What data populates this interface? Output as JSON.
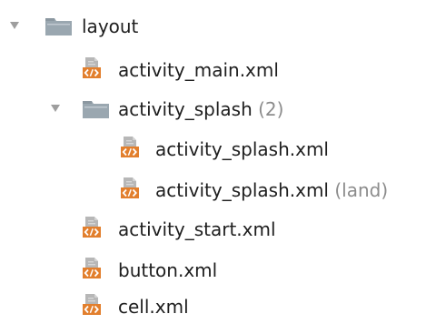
{
  "tree": {
    "layout_folder": {
      "name": "layout",
      "icon": "folder-icon",
      "expanded": true
    },
    "activity_main": {
      "name": "activity_main.xml",
      "icon": "xml-layout-file-icon"
    },
    "activity_splash_group": {
      "name": "activity_splash",
      "count": "(2)",
      "icon": "folder-icon",
      "expanded": true
    },
    "activity_splash_file": {
      "name": "activity_splash.xml",
      "icon": "xml-layout-file-icon"
    },
    "activity_splash_land": {
      "name": "activity_splash.xml",
      "qualifier": "(land)",
      "icon": "xml-layout-file-icon"
    },
    "activity_start": {
      "name": "activity_start.xml",
      "icon": "xml-layout-file-icon"
    },
    "button": {
      "name": "button.xml",
      "icon": "xml-layout-file-icon"
    },
    "cell": {
      "name": "cell.xml",
      "icon": "xml-layout-file-icon"
    }
  },
  "colors": {
    "arrow": "#9e9e9e",
    "folder": "#9aa7b0",
    "folder_tab": "#8b97a0",
    "xml_sheet": "#b7b7b7",
    "xml_badge": "#e27f2d",
    "hint_text": "#8c8c8c"
  }
}
